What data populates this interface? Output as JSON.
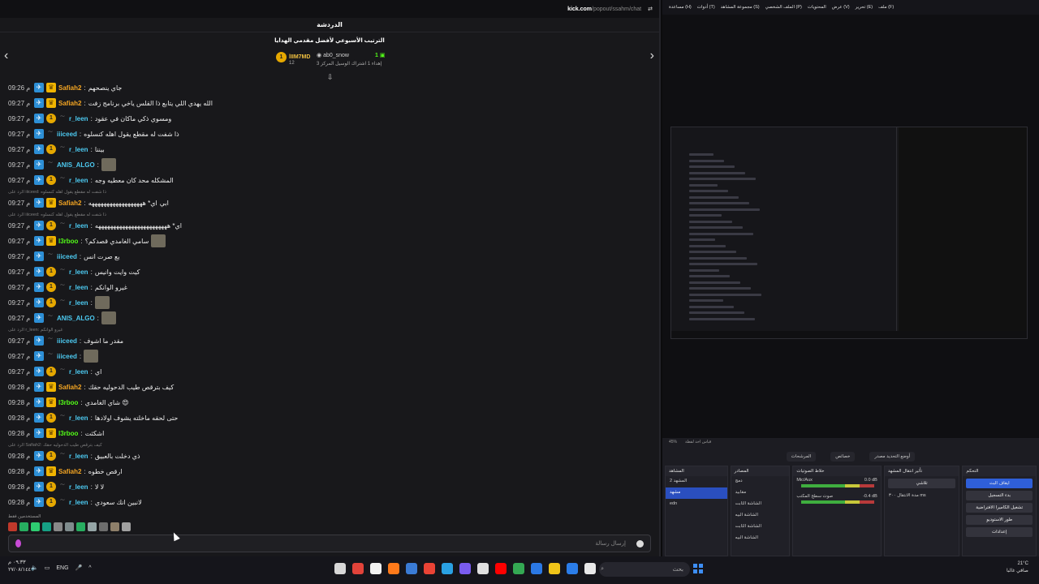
{
  "chat": {
    "url_host": "kick.com",
    "url_path": "/popout/ssahm/chat",
    "header": "الدردشة",
    "leaderboard_title": "الترتيب الأسبوعي لأفضل مقدمي الهدايا",
    "first_name": "lIIM7MD",
    "first_count": "12",
    "first_rank": "1",
    "second_name": "ab0_snow",
    "second_sub": "إهداء 1 اشتراك الوسيل المركز 3",
    "third_count": "1",
    "emote_label": "المستخدمين فقط",
    "input_placeholder": "إرسال رسالة",
    "messages": [
      {
        "time": "09:26 م",
        "user": "Safiah2",
        "color": "#f5a623",
        "badges": [
          "blue",
          "crown"
        ],
        "text": "جاي ينصحهم"
      },
      {
        "time": "09:27 م",
        "user": "Safiah2",
        "color": "#f5a623",
        "badges": [
          "blue",
          "crown"
        ],
        "text": "الله يهدي اللي يتابع ذا القلس ياخي برنامج زفت"
      },
      {
        "time": "09:27 م",
        "user": "r_leen",
        "color": "#4cc9f0",
        "badges": [
          "blue",
          "gift",
          "gr"
        ],
        "text": "ومسوي ذكي ماكان في عقود"
      },
      {
        "time": "09:27 م",
        "user": "iiiceed",
        "color": "#4cc9f0",
        "badges": [
          "blue",
          "gr"
        ],
        "text": "ذا شفت له مقطع يقول اهله كنسلوه"
      },
      {
        "time": "09:27 م",
        "user": "r_leen",
        "color": "#4cc9f0",
        "badges": [
          "blue",
          "gift",
          "gr"
        ],
        "text": "بيننا"
      },
      {
        "time": "09:27 م",
        "user": "ANIS_ALGO",
        "color": "#4cc9f0",
        "badges": [
          "blue",
          "gr"
        ],
        "text": "",
        "emote": true
      },
      {
        "time": "09:27 م",
        "user": "r_leen",
        "color": "#4cc9f0",
        "badges": [
          "blue",
          "gift",
          "gr"
        ],
        "text": "المشكله محد كان معطيه وجه"
      },
      {
        "reply": "الرد على iiiceed: ذا شفت له مقطع يقول اهله كنسلوه"
      },
      {
        "time": "09:27 م",
        "user": "Safiah2",
        "color": "#f5a623",
        "badges": [
          "blue",
          "crown"
        ],
        "text": "اي* ههههههههههههههههههه",
        "tail": "ابي"
      },
      {
        "reply": "الرد على iiiceed: ذا شفت له مقطع يقول اهله كنسلوه"
      },
      {
        "time": "09:27 م",
        "user": "r_leen",
        "color": "#4cc9f0",
        "badges": [
          "blue",
          "gift",
          "gr"
        ],
        "text": "اي* ههههههههههههههههههههههههه"
      },
      {
        "time": "09:27 م",
        "user": "l3rboo",
        "color": "#53fc18",
        "badges": [
          "blue",
          "crown"
        ],
        "text": "سامي الغامدي قصدكم؟",
        "emote": true
      },
      {
        "time": "09:27 م",
        "user": "iiiceed",
        "color": "#4cc9f0",
        "badges": [
          "blue",
          "gr"
        ],
        "text": "يع صرت انس"
      },
      {
        "time": "09:27 م",
        "user": "r_leen",
        "color": "#4cc9f0",
        "badges": [
          "blue",
          "gift",
          "gr"
        ],
        "text": "كيت وايت وانيس"
      },
      {
        "time": "09:27 م",
        "user": "r_leen",
        "color": "#4cc9f0",
        "badges": [
          "blue",
          "gift",
          "gr"
        ],
        "text": "غيرو الوانكم"
      },
      {
        "time": "09:27 م",
        "user": "r_leen",
        "color": "#4cc9f0",
        "badges": [
          "blue",
          "gift",
          "gr"
        ],
        "text": "",
        "emote": true
      },
      {
        "time": "09:27 م",
        "user": "ANIS_ALGO",
        "color": "#4cc9f0",
        "badges": [
          "blue",
          "gr"
        ],
        "text": "",
        "emote": true
      },
      {
        "reply": "الرد على r_leen: غيرو الوانكم"
      },
      {
        "time": "09:27 م",
        "user": "iiiceed",
        "color": "#4cc9f0",
        "badges": [
          "blue",
          "gr"
        ],
        "text": "مقدر ما اشوف"
      },
      {
        "time": "09:27 م",
        "user": "iiiceed",
        "color": "#4cc9f0",
        "badges": [
          "blue",
          "gr"
        ],
        "text": "",
        "emote": true
      },
      {
        "time": "09:27 م",
        "user": "r_leen",
        "color": "#4cc9f0",
        "badges": [
          "blue",
          "gift",
          "gr"
        ],
        "text": "اي"
      },
      {
        "time": "09:28 م",
        "user": "Safiah2",
        "color": "#f5a623",
        "badges": [
          "blue",
          "crown"
        ],
        "text": "كيف بترقص طيب الدحوليه حقك"
      },
      {
        "time": "09:28 م",
        "user": "l3rboo",
        "color": "#53fc18",
        "badges": [
          "blue",
          "crown"
        ],
        "text": "شاي الغامدي 😍"
      },
      {
        "time": "09:28 م",
        "user": "r_leen",
        "color": "#4cc9f0",
        "badges": [
          "blue",
          "gift",
          "gr"
        ],
        "text": "حتى لحقه ماخلته يشوف اولادها"
      },
      {
        "time": "09:28 م",
        "user": "l3rboo",
        "color": "#53fc18",
        "badges": [
          "blue",
          "crown"
        ],
        "text": "اشكثت"
      },
      {
        "reply": "الرد على Safiah2: كيف بترقص طيب الدحوليه حقك"
      },
      {
        "time": "09:28 م",
        "user": "r_leen",
        "color": "#4cc9f0",
        "badges": [
          "blue",
          "gift",
          "gr"
        ],
        "text": "ذي دخلت بالعبيق"
      },
      {
        "time": "09:28 م",
        "user": "Safiah2",
        "color": "#f5a623",
        "badges": [
          "blue",
          "crown"
        ],
        "text": "ارقص خطوه"
      },
      {
        "time": "09:28 م",
        "user": "r_leen",
        "color": "#4cc9f0",
        "badges": [
          "blue",
          "gift",
          "gr"
        ],
        "text": "لا لا"
      },
      {
        "time": "09:28 م",
        "user": "r_leen",
        "color": "#4cc9f0",
        "badges": [
          "blue",
          "gift",
          "gr"
        ],
        "text": "لانبين انك سعودي"
      }
    ]
  },
  "obs": {
    "menu": [
      "مساعدة (H)",
      "أدوات (T)",
      "مجموعة المشاهد (S)",
      "الملف الشخصي (P)",
      "المحتويات",
      "عرض (V)",
      "تحرير (E)",
      "ملف (F)"
    ],
    "status_left": "45%",
    "status_right": "قياس اخذ لقطة",
    "tabs": [
      "المرشحات",
      "خصائص",
      "أوضع التحديد مصدر"
    ],
    "docks": {
      "scenes_title": "المشاهد",
      "scenes": [
        "المشهد 2",
        "مشهد",
        "edn"
      ],
      "selected_scene_index": 1,
      "sources_title": "المصادر",
      "sources": [
        "دمج",
        "مقابيد",
        "الشاشة الثابت",
        "الشاشة البيه",
        "الشاشة الثابت",
        "الشاشة البيه"
      ],
      "mixer_title": "خلاط الصوتيات",
      "mixer": [
        {
          "name": "Mic/Aux",
          "level": "0.0 dB"
        },
        {
          "name": "صوت سطح المكتب",
          "level": "-0.4 dB"
        }
      ],
      "transitions_title": "تأثير انتقال المشهد",
      "transition": "تلاشي",
      "duration_label": "مدة الانتقال",
      "duration": "٣٠٠ ms",
      "controls_title": "التحكم",
      "controls": [
        "ايقاف البث",
        "بدء التسجيل",
        "تشغيل الكاميرا الافتراضية",
        "طور الاستوديو",
        "إعدادات"
      ]
    }
  },
  "taskbar": {
    "time": "٠٩:٣٣ م",
    "date": "٢٧/٠٨/١٤٤٦",
    "lang": "ENG",
    "search_placeholder": "بحث",
    "temp": "21°C",
    "weather": "صافي غالبا"
  }
}
